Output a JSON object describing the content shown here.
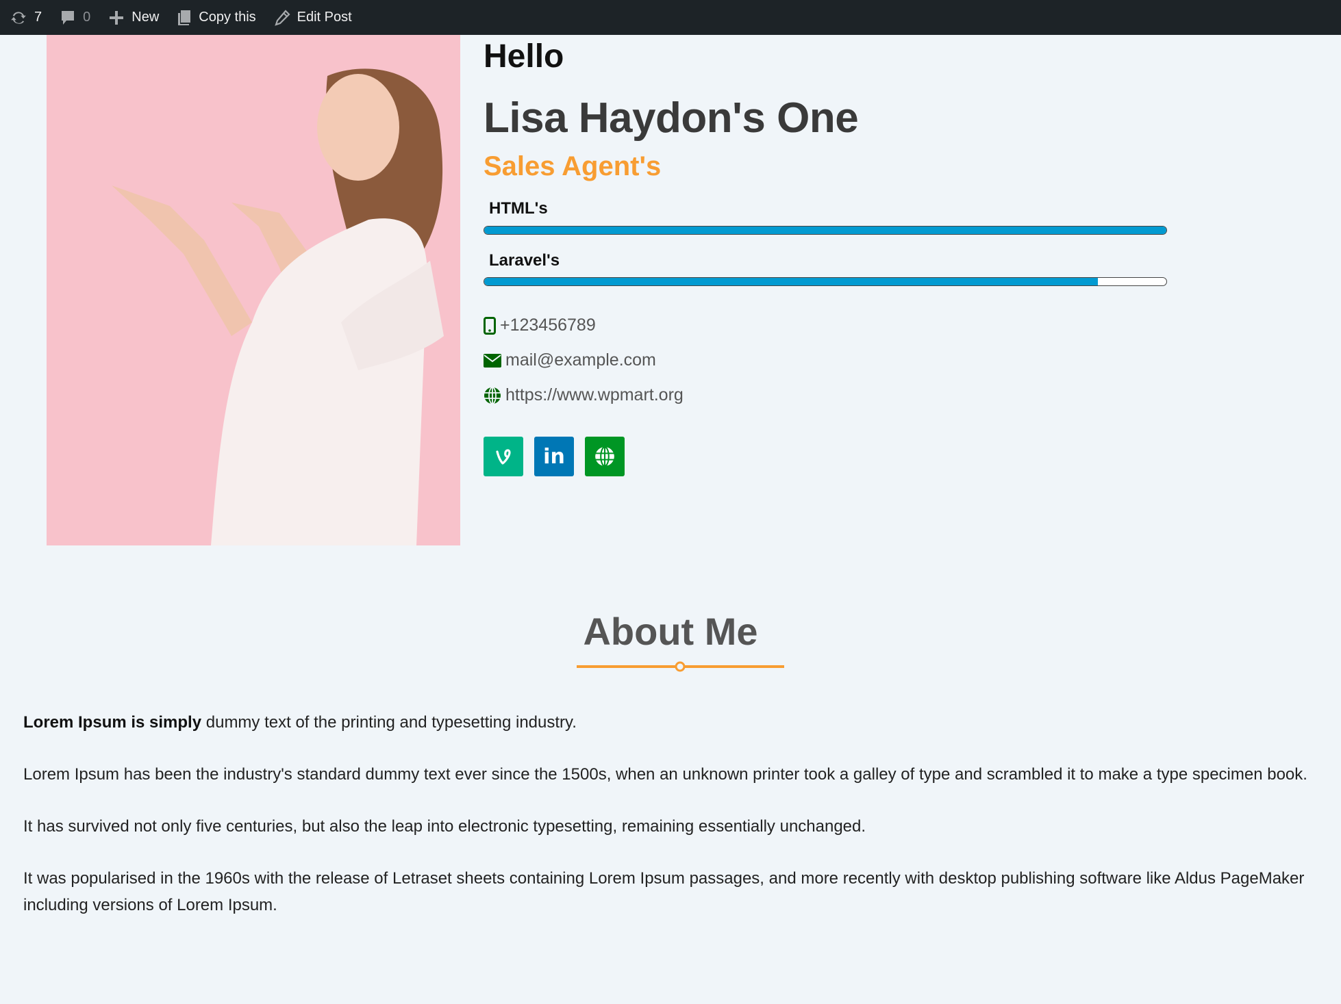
{
  "adminbar": {
    "updates_count": "7",
    "comments_count": "0",
    "new_label": "New",
    "copy_label": "Copy this",
    "edit_label": "Edit Post"
  },
  "profile": {
    "greeting": "Hello",
    "name": "Lisa Haydon's One",
    "role": "Sales Agent's",
    "photo_alt": "Woman in white blouse pointing left against pink background",
    "skills": [
      {
        "label": "HTML's",
        "percent": 100
      },
      {
        "label": "Laravel's",
        "percent": 90
      }
    ],
    "contacts": {
      "phone": "+123456789",
      "email": "mail@example.com",
      "website": "https://www.wpmart.org"
    },
    "social": [
      {
        "name": "vine",
        "glyph": "V",
        "color": "#00b488"
      },
      {
        "name": "linkedin",
        "glyph": "in",
        "color": "#0077b5"
      },
      {
        "name": "website",
        "glyph": "globe",
        "color": "#009624"
      }
    ]
  },
  "about": {
    "title": "About Me",
    "intro_bold": "Lorem Ipsum is simply",
    "intro_rest": " dummy text of the printing and typesetting industry.",
    "paragraphs": [
      "Lorem Ipsum has been the industry's standard dummy text ever since the 1500s, when an unknown printer took a galley of type and scrambled it to make a type specimen book.",
      "It has survived not only five centuries, but also the leap into electronic typesetting, remaining essentially unchanged.",
      "It was popularised in the 1960s with the release of Letraset sheets containing Lorem Ipsum passages, and more recently with desktop publishing software like Aldus PageMaker including versions of Lorem Ipsum."
    ]
  },
  "colors": {
    "accent": "#f89d32",
    "bar_fill": "#029ad1",
    "icon_green": "#006400",
    "adminbar_bg": "#1d2327",
    "page_bg": "#f0f5f9"
  }
}
